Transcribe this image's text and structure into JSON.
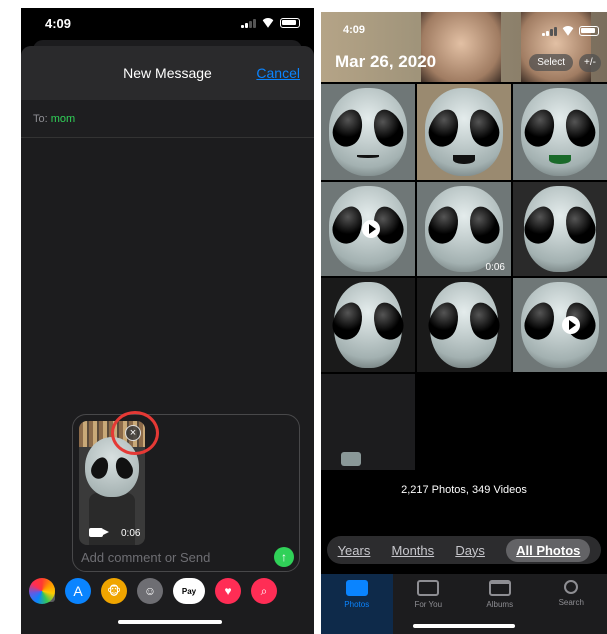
{
  "messages": {
    "status": {
      "time": "4:09"
    },
    "sheet": {
      "title": "New Message",
      "cancel_label": "Cancel"
    },
    "to": {
      "label": "To:",
      "recipient": "mom"
    },
    "attachment": {
      "duration": "0:06"
    },
    "composer": {
      "placeholder": "Add comment or Send"
    },
    "apps": [
      "photos",
      "app-store",
      "animoji",
      "memoji-stickers",
      "apple-pay",
      "digital-touch",
      "search-images"
    ],
    "app_labels": {
      "pay": "Pay"
    },
    "colors": {
      "accent": "#0a84ff",
      "recipient": "#30d158",
      "highlight": "#e53935"
    }
  },
  "photos": {
    "status": {
      "time": "4:09"
    },
    "header": {
      "date": "Mar 26, 2020",
      "select_label": "Select",
      "zoom_label": "+/-"
    },
    "grid_video_duration": "0:06",
    "library_count": "2,217 Photos, 349 Videos",
    "segments": [
      {
        "label": "Years",
        "active": false
      },
      {
        "label": "Months",
        "active": false
      },
      {
        "label": "Days",
        "active": false
      },
      {
        "label": "All Photos",
        "active": true
      }
    ],
    "tabs": [
      {
        "label": "Photos",
        "active": true
      },
      {
        "label": "For You",
        "active": false
      },
      {
        "label": "Albums",
        "active": false
      },
      {
        "label": "Search",
        "active": false
      }
    ]
  }
}
